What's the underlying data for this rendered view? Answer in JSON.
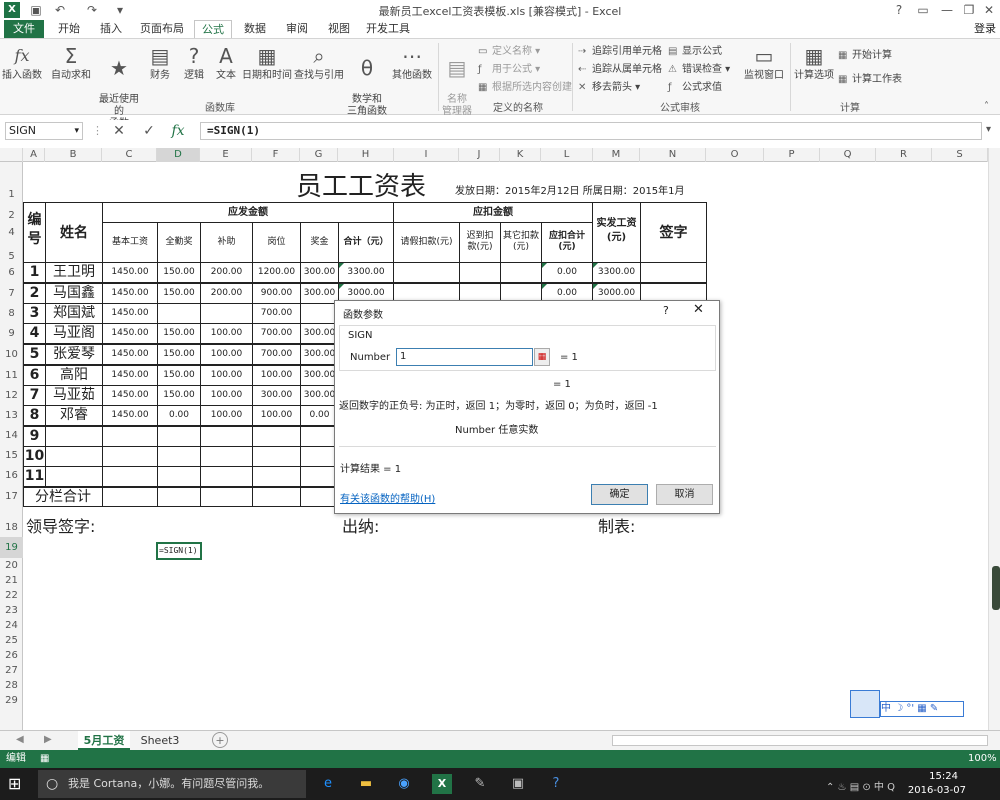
{
  "window": {
    "title": "最新员工excel工资表模板.xls  [兼容模式] - Excel",
    "login": "登录",
    "controls": {
      "help": "?",
      "minimize": "—",
      "restore": "❐",
      "close": "✕"
    }
  },
  "tabs": [
    "文件",
    "开始",
    "插入",
    "页面布局",
    "公式",
    "数据",
    "审阅",
    "视图",
    "开发工具"
  ],
  "ribbon": {
    "big_buttons": [
      {
        "label": "插入函数",
        "icon": "fx-icon",
        "glyph": "fx"
      },
      {
        "label": "自动求和",
        "icon": "sigma-icon",
        "glyph": "Σ"
      },
      {
        "label": "最近使用的\n函数",
        "icon": "star-book-icon",
        "glyph": "★"
      },
      {
        "label": "财务",
        "icon": "book-icon",
        "glyph": "▤"
      },
      {
        "label": "逻辑",
        "icon": "question-book-icon",
        "glyph": "?"
      },
      {
        "label": "文本",
        "icon": "a-book-icon",
        "glyph": "A"
      },
      {
        "label": "日期和时间",
        "icon": "calendar-book-icon",
        "glyph": "▦"
      },
      {
        "label": "查找与引用",
        "icon": "search-book-icon",
        "glyph": "⌕"
      },
      {
        "label": "数学和\n三角函数",
        "icon": "theta-book-icon",
        "glyph": "θ"
      },
      {
        "label": "其他函数",
        "icon": "more-book-icon",
        "glyph": "⋯"
      }
    ],
    "group_function_library": "函数库",
    "name_manager": "名称\n管理器",
    "defined_names": [
      "定义名称",
      "用于公式",
      "根据所选内容创建"
    ],
    "group_defined_names": "定义的名称",
    "audit_left": [
      "追踪引用单元格",
      "追踪从属单元格",
      "移去箭头"
    ],
    "audit_right": [
      "显示公式",
      "错误检查",
      "公式求值"
    ],
    "watch_window": "监视窗口",
    "group_audit": "公式审核",
    "calc_options": "计算选项",
    "calc_now": "开始计算",
    "calc_sheet": "计算工作表",
    "group_calc": "计算"
  },
  "formula_bar": {
    "name_box": "SIGN",
    "cancel_glyph": "✕",
    "enter_glyph": "✓",
    "insert_glyph": "fx",
    "formula": "=SIGN(1)"
  },
  "columns": [
    "A",
    "B",
    "C",
    "D",
    "E",
    "F",
    "G",
    "H",
    "I",
    "J",
    "K",
    "L",
    "M",
    "N",
    "O",
    "P",
    "Q",
    "R",
    "S"
  ],
  "rows": [
    "1",
    "2",
    "3",
    "4",
    "5",
    "6",
    "7",
    "8",
    "9",
    "10",
    "11",
    "12",
    "13",
    "14",
    "15",
    "16",
    "17",
    "18",
    "19",
    "20",
    "21",
    "22",
    "23",
    "24",
    "25",
    "26",
    "27",
    "28",
    "29"
  ],
  "sheet": {
    "title": "员工工资表",
    "issue_info": "发放日期：2015年2月12日 所属日期：2015年1月",
    "h_id": "编\n号",
    "h_name": "姓名",
    "h_payable": "应发金额",
    "h_deduct": "应扣金额",
    "h_net": "实发工资\n(元)",
    "h_sign": "签字",
    "sub_pay": [
      "基本工资",
      "全勤奖",
      "补助",
      "岗位",
      "奖金",
      "合计（元）"
    ],
    "sub_ded": [
      "请假扣款(元)",
      "迟到扣\n款(元)",
      "其它扣款\n(元)",
      "应扣合计\n(元)"
    ],
    "employees": [
      {
        "id": "1",
        "name": "王卫明",
        "base": "1450.00",
        "att": "150.00",
        "sub": "200.00",
        "post": "1200.00",
        "bonus": "300.00",
        "total": "3300.00",
        "ded": "0.00",
        "net": "3300.00"
      },
      {
        "id": "2",
        "name": "马国鑫",
        "base": "1450.00",
        "att": "150.00",
        "sub": "200.00",
        "post": "900.00",
        "bonus": "300.00",
        "total": "3000.00",
        "ded": "0.00",
        "net": "3000.00"
      },
      {
        "id": "3",
        "name": "郑国斌",
        "base": "1450.00",
        "att": "",
        "sub": "",
        "post": "700.00",
        "bonus": "",
        "total": "",
        "ded": "",
        "net": ""
      },
      {
        "id": "4",
        "name": "马亚阁",
        "base": "1450.00",
        "att": "150.00",
        "sub": "100.00",
        "post": "700.00",
        "bonus": "300.00",
        "total": "",
        "ded": "",
        "net": ""
      },
      {
        "id": "5",
        "name": "张爱琴",
        "base": "1450.00",
        "att": "150.00",
        "sub": "100.00",
        "post": "700.00",
        "bonus": "300.00",
        "total": "",
        "ded": "",
        "net": ""
      },
      {
        "id": "6",
        "name": "高阳",
        "base": "1450.00",
        "att": "150.00",
        "sub": "100.00",
        "post": "100.00",
        "bonus": "300.00",
        "total": "",
        "ded": "",
        "net": ""
      },
      {
        "id": "7",
        "name": "马亚茹",
        "base": "1450.00",
        "att": "150.00",
        "sub": "100.00",
        "post": "300.00",
        "bonus": "300.00",
        "total": "",
        "ded": "",
        "net": ""
      },
      {
        "id": "8",
        "name": "邓睿",
        "base": "1450.00",
        "att": "0.00",
        "sub": "100.00",
        "post": "100.00",
        "bonus": "0.00",
        "total": "",
        "ded": "",
        "net": ""
      }
    ],
    "empty_ids": [
      "9",
      "10",
      "11"
    ],
    "subtotal": "分栏合计",
    "leader_sign": "领导签字:",
    "cashier": "出纳:",
    "preparer": "制表:",
    "active_cell_text": "=SIGN(1)"
  },
  "dialog": {
    "title": "函数参数",
    "help": "?",
    "close": "✕",
    "func_name": "SIGN",
    "arg_label": "Number",
    "arg_value": "1",
    "ref_glyph": "▦",
    "arg_eq": "=  1",
    "result_eq": "=  1",
    "description": "返回数字的正负号: 为正时，返回 1；为零时，返回 0；为负时，返回 -1",
    "arg_description": "Number  任意实数",
    "calc_result": "计算结果 =   1",
    "help_link": "有关该函数的帮助(H)",
    "ok": "确定",
    "cancel": "取消"
  },
  "sheet_tabs": [
    "5月工资",
    "Sheet3"
  ],
  "status": {
    "mode": "编辑",
    "zoom": "100%"
  },
  "taskbar": {
    "cortana": "我是 Cortana，小娜。有问题尽管问我。",
    "time": "15:24",
    "date": "2016-03-07"
  },
  "ime": "中 ☽ °' ▦ ✎",
  "colors": {
    "excel_green": "#217346",
    "link_blue": "#0563c1",
    "focus_blue": "#3c7fb1"
  }
}
